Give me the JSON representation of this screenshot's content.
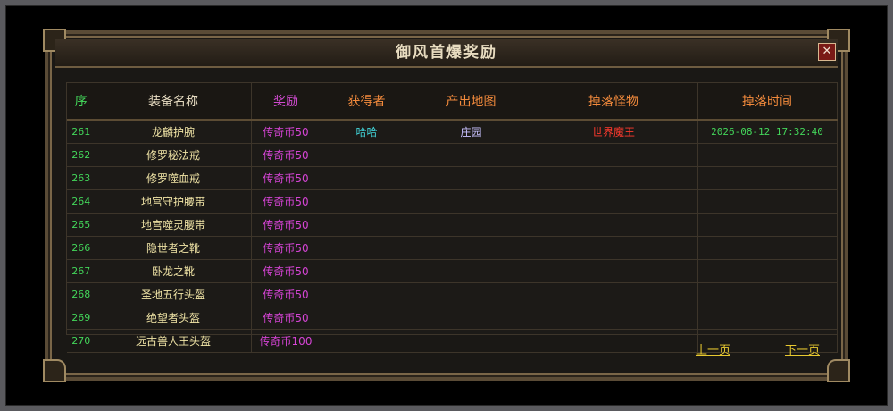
{
  "dialog": {
    "title": "御风首爆奖励",
    "close_label": "✕"
  },
  "table": {
    "headers": [
      "序",
      "装备名称",
      "奖励",
      "获得者",
      "产出地图",
      "掉落怪物",
      "掉落时间"
    ],
    "rows": [
      {
        "seq": "261",
        "name": "龙麟护腕",
        "reward": "传奇币50",
        "getter": "哈哈",
        "map": "庄园",
        "monster": "世界魔王",
        "time": "2026-08-12 17:32:40"
      },
      {
        "seq": "262",
        "name": "修罗秘法戒",
        "reward": "传奇币50",
        "getter": "",
        "map": "",
        "monster": "",
        "time": ""
      },
      {
        "seq": "263",
        "name": "修罗噬血戒",
        "reward": "传奇币50",
        "getter": "",
        "map": "",
        "monster": "",
        "time": ""
      },
      {
        "seq": "264",
        "name": "地宫守护腰带",
        "reward": "传奇币50",
        "getter": "",
        "map": "",
        "monster": "",
        "time": ""
      },
      {
        "seq": "265",
        "name": "地宫噬灵腰带",
        "reward": "传奇币50",
        "getter": "",
        "map": "",
        "monster": "",
        "time": ""
      },
      {
        "seq": "266",
        "name": "隐世者之靴",
        "reward": "传奇币50",
        "getter": "",
        "map": "",
        "monster": "",
        "time": ""
      },
      {
        "seq": "267",
        "name": "卧龙之靴",
        "reward": "传奇币50",
        "getter": "",
        "map": "",
        "monster": "",
        "time": ""
      },
      {
        "seq": "268",
        "name": "圣地五行头盔",
        "reward": "传奇币50",
        "getter": "",
        "map": "",
        "monster": "",
        "time": ""
      },
      {
        "seq": "269",
        "name": "绝望者头盔",
        "reward": "传奇币50",
        "getter": "",
        "map": "",
        "monster": "",
        "time": ""
      },
      {
        "seq": "270",
        "name": "远古兽人王头盔",
        "reward": "传奇币100",
        "getter": "",
        "map": "",
        "monster": "",
        "time": ""
      }
    ]
  },
  "pager": {
    "prev_label": "上一页",
    "next_label": "下一页"
  }
}
